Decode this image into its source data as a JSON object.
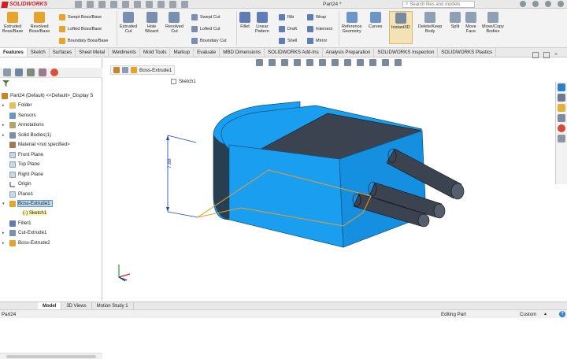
{
  "app": {
    "logo_text": "SOLIDWORKS",
    "doc_title": "Part24 *",
    "search_placeholder": "Search files and models"
  },
  "commands": {
    "extruded_boss": "Extruded\nBoss/Base",
    "revolved_boss": "Revolved\nBoss/Base",
    "swept_boss": "Swept Boss/Base",
    "lofted_boss": "Lofted Boss/Base",
    "boundary_boss": "Boundary Boss/Base",
    "extruded_cut": "Extruded\nCut",
    "hole_wizard": "Hole\nWizard",
    "revolved_cut": "Revolved\nCut",
    "swept_cut": "Swept Cut",
    "lofted_cut": "Lofted Cut",
    "boundary_cut": "Boundary Cut",
    "fillet": "Fillet",
    "linear_pattern": "Linear\nPattern",
    "rib": "Rib",
    "draft": "Draft",
    "shell": "Shell",
    "wrap": "Wrap",
    "intersect": "Intersect",
    "mirror": "Mirror",
    "ref_geometry": "Reference\nGeometry",
    "curves": "Curves",
    "instant3d": "Instant3D",
    "delete_keep": "Delete/Keep\nBody",
    "split": "Split",
    "move_face": "Move\nFace",
    "move_copy": "Move/Copy\nBodies"
  },
  "tabs": [
    "Features",
    "Sketch",
    "Surfaces",
    "Sheet Metal",
    "Weldments",
    "Mold Tools",
    "Markup",
    "Evaluate",
    "MBD Dimensions",
    "SOLIDWORKS Add-Ins",
    "Analysis Preparation",
    "SOLIDWORKS Inspection",
    "SOLIDWORKS Plastics"
  ],
  "tree": {
    "root": "Part24 (Default) <<Default>_Display S",
    "items": [
      "Folder",
      "Sensors",
      "Annotations",
      "Solid Bodies(1)",
      "Material <not specified>",
      "Front Plane",
      "Top Plane",
      "Right Plane",
      "Origin",
      "Plane1",
      "Boss-Extrude1",
      "(-) Sketch1",
      "Fillet1",
      "Cut-Extrude1",
      "Boss-Extrude2"
    ]
  },
  "viewport": {
    "breadcrumb": "Boss-Extrude1",
    "breadcrumb_sub": "Sketch1",
    "dimension": "7.88"
  },
  "bottom_tabs": [
    "Model",
    "3D Views",
    "Motion Study 1"
  ],
  "status": {
    "left": "Part24",
    "mid": "Editing Part",
    "right": "Custom",
    "help": "?"
  },
  "colors": {
    "body": "#1a9ff0",
    "dark_face": "#3b4350",
    "sketch_line": "#f59a1e",
    "dim_blue": "#1f3fbf"
  }
}
